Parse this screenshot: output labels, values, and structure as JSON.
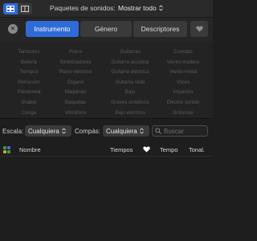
{
  "view_toggle": {
    "icons": [
      "grid-view-icon",
      "column-view-icon"
    ],
    "active": 0
  },
  "packs": {
    "label": "Paquetes de sonidos:",
    "value": "Mostrar todo"
  },
  "tabs": [
    {
      "label": "Instrumento",
      "active": true
    },
    {
      "label": "Género",
      "active": false
    },
    {
      "label": "Descriptores",
      "active": false
    }
  ],
  "keywords": [
    [
      "Tambores",
      "Piano",
      "Guitarras",
      "Cuerdas"
    ],
    [
      "Batería",
      "Sintetizadores",
      "Guitarra acústica",
      "Viento-madera"
    ],
    [
      "Tiempos",
      "Piano eléctrico",
      "Guitarra eléctrica",
      "Viento-metal"
    ],
    [
      "Percusión",
      "Órgano",
      "Guitarra slide",
      "Voces"
    ],
    [
      "Pandereta",
      "Máquinas",
      "Bajo",
      "Impactos"
    ],
    [
      "Shaker",
      "Baquetas",
      "Graves sintéticos",
      "Efectos sonido"
    ],
    [
      "Conga",
      "Vibráfono",
      "Bajo eléctrico",
      "Sintonías"
    ]
  ],
  "filters": {
    "scale_label": "Escala:",
    "scale_value": "Cualquiera",
    "signature_label": "Compás:",
    "signature_value": "Cualquiera",
    "search_placeholder": "Buscar"
  },
  "columns": {
    "name": "Nombre",
    "beats": "Tiempos",
    "favorite_icon": "heart-icon",
    "tempo": "Tempo",
    "key": "Tonal."
  },
  "colors": {
    "accent": "#2f6bd8",
    "background": "#1e1e1e",
    "keyword_text": "#5a5a5a"
  }
}
